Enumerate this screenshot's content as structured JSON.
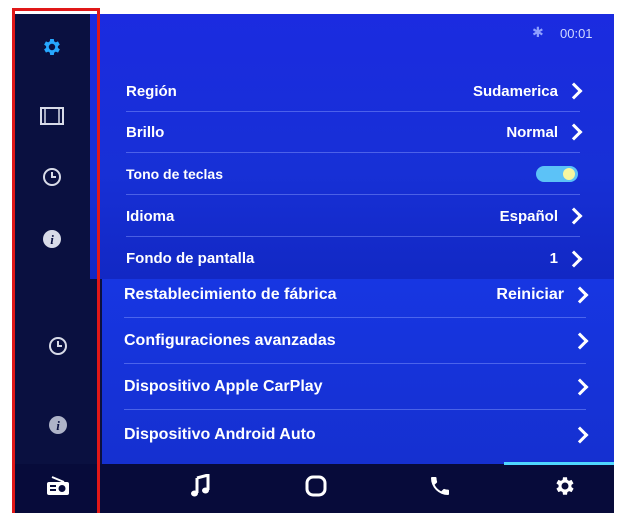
{
  "status": {
    "bluetooth_icon": "bluetooth-icon",
    "time": "00:01"
  },
  "sidebar": {
    "items": [
      {
        "icon": "gear-icon",
        "active": true
      },
      {
        "icon": "film-icon"
      },
      {
        "icon": "clock-icon"
      },
      {
        "icon": "info-icon"
      },
      {
        "icon": "clock-icon"
      },
      {
        "icon": "info-icon"
      },
      {
        "icon": "radio-icon"
      }
    ]
  },
  "settings": {
    "region": {
      "label": "Región",
      "value": "Sudamerica"
    },
    "brightness": {
      "label": "Brillo",
      "value": "Normal"
    },
    "key_tone": {
      "label": "Tono de teclas",
      "enabled": true
    },
    "language": {
      "label": "Idioma",
      "value": "Español"
    },
    "wallpaper": {
      "label": "Fondo de pantalla",
      "value": "1"
    },
    "factory_reset": {
      "label": "Restablecimiento de fábrica",
      "value": "Reiniciar"
    },
    "advanced": {
      "label": "Configuraciones avanzadas"
    },
    "carplay": {
      "label": "Dispositivo Apple CarPlay"
    },
    "android_auto": {
      "label": "Dispositivo Android Auto"
    }
  },
  "bottom_nav": {
    "items": [
      "radio-icon",
      "music-note-icon",
      "home-icon",
      "phone-icon",
      "gear-icon"
    ],
    "active": "gear-icon"
  },
  "colors": {
    "accent": "#4fd7ff",
    "toggle_on": "#5cc2f7",
    "panel_blue": "#1b2be0"
  }
}
